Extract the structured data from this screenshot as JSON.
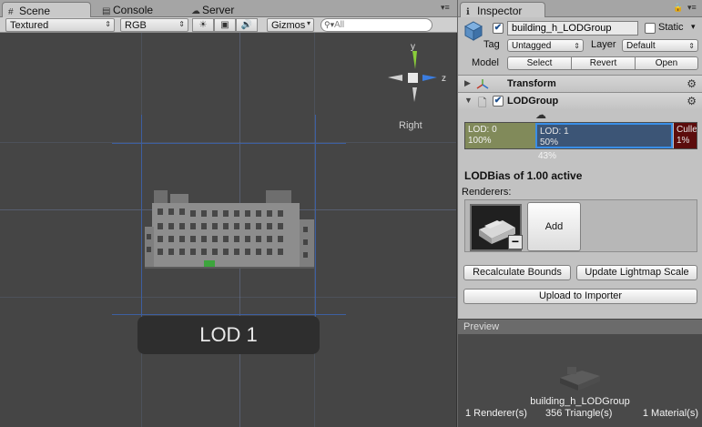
{
  "scene_panel": {
    "tabs": [
      {
        "label": "Scene",
        "icon": "grid-icon",
        "active": true
      },
      {
        "label": "Console",
        "icon": "console-icon",
        "active": false
      },
      {
        "label": "Server",
        "icon": "server-icon",
        "active": false
      }
    ],
    "toolbar": {
      "render_mode": "Textured",
      "color_mode": "RGB",
      "gizmos_label": "Gizmos",
      "search_placeholder": "All"
    },
    "gizmo": {
      "y_label": "y",
      "z_label": "z",
      "view_label": "Right"
    },
    "lod_overlay_label": "LOD 1"
  },
  "inspector": {
    "tab_label": "Inspector",
    "object": {
      "name": "building_h_LODGroup",
      "active": true,
      "static_label": "Static",
      "static_checked": false,
      "tag_label": "Tag",
      "tag_value": "Untagged",
      "layer_label": "Layer",
      "layer_value": "Default",
      "model_label": "Model",
      "model_buttons": [
        "Select",
        "Revert",
        "Open"
      ]
    },
    "components": {
      "transform_label": "Transform",
      "lodgroup_label": "LODGroup",
      "lodgroup_enabled": true
    },
    "lod_bar": {
      "segments": [
        {
          "name": "LOD: 0",
          "percent": "100%",
          "color": "#818a5a"
        },
        {
          "name": "LOD: 1",
          "percent": "50%",
          "color": "#3c5576"
        },
        {
          "name": "Culled",
          "percent": "1%",
          "color": "#5c0c0c"
        }
      ],
      "current_marker": "43%"
    },
    "lod_bias_text": "LODBias of 1.00 active",
    "renderers_label": "Renderers:",
    "add_button": "Add",
    "recalculate_bounds": "Recalculate Bounds",
    "update_lightmap_scale": "Update Lightmap Scale",
    "upload_to_importer": "Upload to Importer"
  },
  "preview": {
    "header": "Preview",
    "object_name": "building_h_LODGroup",
    "stats": [
      "1 Renderer(s)",
      "356 Triangle(s)",
      "1 Material(s)"
    ]
  }
}
